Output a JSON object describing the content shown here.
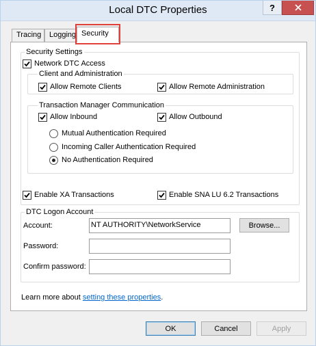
{
  "window": {
    "title": "Local DTC Properties",
    "help_button": "?",
    "close_button": "X"
  },
  "tabs": [
    {
      "label": "Tracing",
      "active": false
    },
    {
      "label": "Logging",
      "active": false
    },
    {
      "label": "Security",
      "active": true
    }
  ],
  "security_settings": {
    "legend": "Security Settings",
    "network_dtc_access": {
      "label": "Network DTC Access",
      "checked": true
    },
    "client_admin": {
      "legend": "Client and Administration",
      "allow_remote_clients": {
        "label": "Allow Remote Clients",
        "checked": true
      },
      "allow_remote_admin": {
        "label": "Allow Remote Administration",
        "checked": true
      }
    },
    "tm_comm": {
      "legend": "Transaction Manager Communication",
      "allow_inbound": {
        "label": "Allow Inbound",
        "checked": true
      },
      "allow_outbound": {
        "label": "Allow Outbound",
        "checked": true
      },
      "auth_options": [
        {
          "label": "Mutual Authentication Required",
          "selected": false
        },
        {
          "label": "Incoming Caller Authentication Required",
          "selected": false
        },
        {
          "label": "No Authentication Required",
          "selected": true
        }
      ]
    },
    "enable_xa": {
      "label": "Enable XA Transactions",
      "checked": true
    },
    "enable_sna": {
      "label": "Enable SNA LU 6.2 Transactions",
      "checked": true
    }
  },
  "logon_account": {
    "legend": "DTC Logon Account",
    "account_label": "Account:",
    "account_value": "NT AUTHORITY\\NetworkService",
    "browse_label": "Browse...",
    "password_label": "Password:",
    "password_value": "",
    "confirm_label": "Confirm password:",
    "confirm_value": ""
  },
  "learn_more": {
    "prefix": "Learn more about ",
    "link": "setting these properties",
    "suffix": "."
  },
  "footer": {
    "ok": "OK",
    "cancel": "Cancel",
    "apply": "Apply"
  }
}
